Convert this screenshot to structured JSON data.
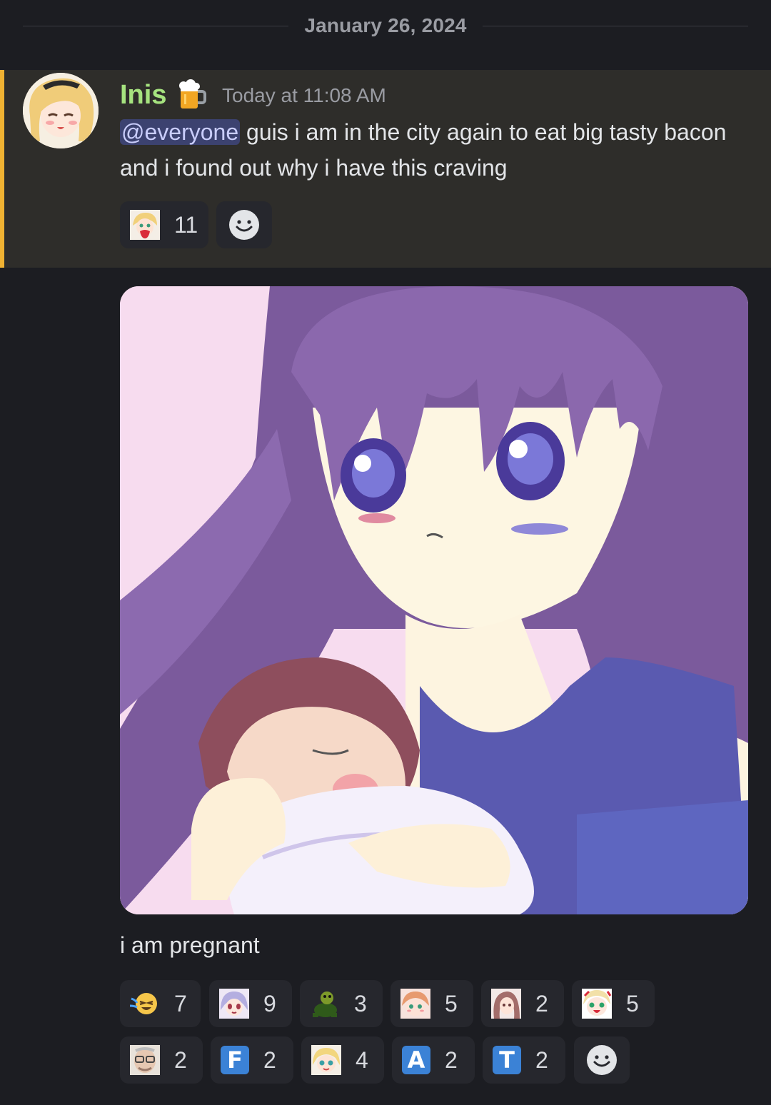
{
  "date_divider": "January 26, 2024",
  "message1": {
    "author": "Inis",
    "author_badge_icon": "beer-mug-icon",
    "timestamp": "Today at 11:08 AM",
    "mention": "@everyone",
    "text": " guis i am in the city again to eat big tasty bacon and i found out why i have this craving",
    "reactions": [
      {
        "emoji": "anime-girl-heart-emoji",
        "count": "11"
      }
    ]
  },
  "message2": {
    "attachment_icon": "anime-mother-holding-baby-image",
    "caption": "i am pregnant",
    "reactions_row1": [
      {
        "emoji": "laughing-crying-face-emoji",
        "count": "7"
      },
      {
        "emoji": "anime-girl-silver-hair-emoji",
        "count": "9"
      },
      {
        "emoji": "turtle-emoji",
        "count": "3"
      },
      {
        "emoji": "anime-girl-blush-emoji",
        "count": "5"
      },
      {
        "emoji": "anime-girl-pink-hair-emoji",
        "count": "2"
      },
      {
        "emoji": "anime-girl-tongue-emoji",
        "count": "5"
      }
    ],
    "reactions_row2": [
      {
        "emoji": "old-man-face-emoji",
        "count": "2"
      },
      {
        "emoji": "regional-indicator-f",
        "letter": "F",
        "count": "2"
      },
      {
        "emoji": "anime-girl-blonde-emoji",
        "count": "4"
      },
      {
        "emoji": "regional-indicator-a",
        "letter": "A",
        "count": "2"
      },
      {
        "emoji": "regional-indicator-t",
        "letter": "T",
        "count": "2"
      }
    ]
  },
  "colors": {
    "background": "#1c1d22",
    "mention_highlight_bg": "#2e2d2a",
    "mention_bar": "#f0b232",
    "username": "#a6e37f",
    "mention_pill": "#3c4270",
    "reaction_bg": "#26272d",
    "regional_indicator": "#3b82d6"
  }
}
